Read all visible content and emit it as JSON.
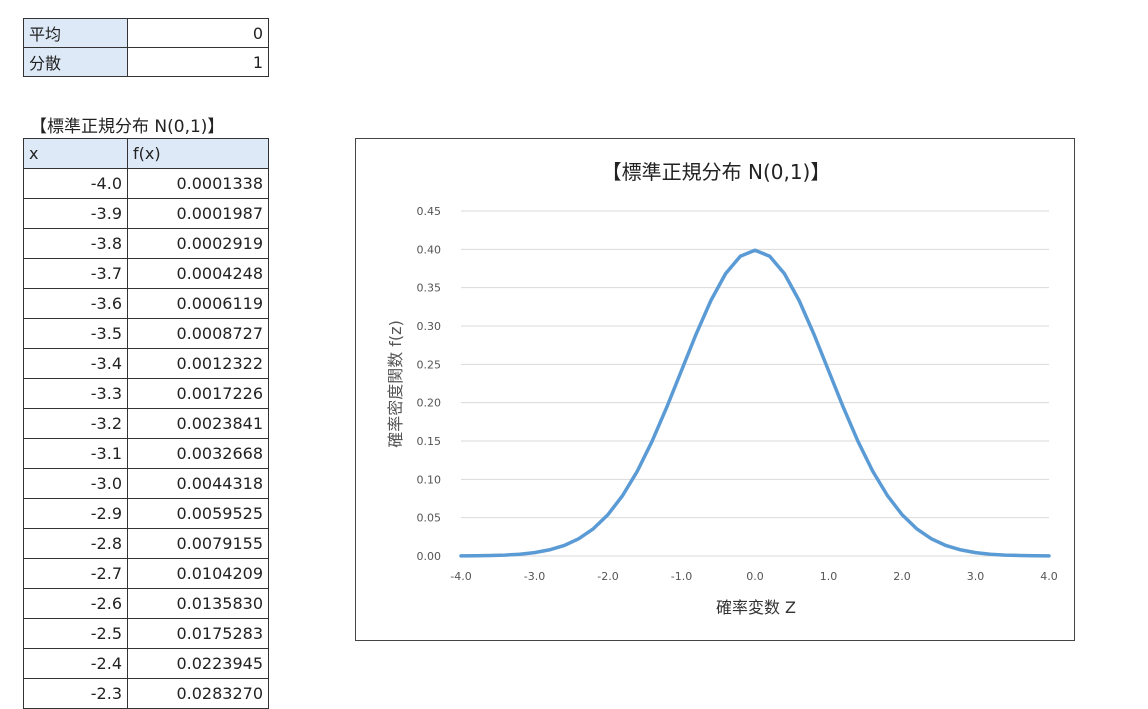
{
  "params": {
    "mean_label": "平均",
    "mean_value": "0",
    "variance_label": "分散",
    "variance_value": "1"
  },
  "table": {
    "title": "【標準正規分布 N(0,1)】",
    "col_x": "x",
    "col_fx": "f(x)",
    "rows": [
      {
        "x": "-4.0",
        "fx": "0.0001338"
      },
      {
        "x": "-3.9",
        "fx": "0.0001987"
      },
      {
        "x": "-3.8",
        "fx": "0.0002919"
      },
      {
        "x": "-3.7",
        "fx": "0.0004248"
      },
      {
        "x": "-3.6",
        "fx": "0.0006119"
      },
      {
        "x": "-3.5",
        "fx": "0.0008727"
      },
      {
        "x": "-3.4",
        "fx": "0.0012322"
      },
      {
        "x": "-3.3",
        "fx": "0.0017226"
      },
      {
        "x": "-3.2",
        "fx": "0.0023841"
      },
      {
        "x": "-3.1",
        "fx": "0.0032668"
      },
      {
        "x": "-3.0",
        "fx": "0.0044318"
      },
      {
        "x": "-2.9",
        "fx": "0.0059525"
      },
      {
        "x": "-2.8",
        "fx": "0.0079155"
      },
      {
        "x": "-2.7",
        "fx": "0.0104209"
      },
      {
        "x": "-2.6",
        "fx": "0.0135830"
      },
      {
        "x": "-2.5",
        "fx": "0.0175283"
      },
      {
        "x": "-2.4",
        "fx": "0.0223945"
      },
      {
        "x": "-2.3",
        "fx": "0.0283270"
      }
    ]
  },
  "chart_data": {
    "type": "line",
    "title": "【標準正規分布 N(0,1)】",
    "xlabel": "確率変数 Z",
    "ylabel": "確率密度関数 f(z)",
    "xlim": [
      -4.0,
      4.0
    ],
    "ylim": [
      0.0,
      0.45
    ],
    "x_ticks": [
      "-4.0",
      "-3.0",
      "-2.0",
      "-1.0",
      "0.0",
      "1.0",
      "2.0",
      "3.0",
      "4.0"
    ],
    "y_ticks": [
      "0.00",
      "0.05",
      "0.10",
      "0.15",
      "0.20",
      "0.25",
      "0.30",
      "0.35",
      "0.40",
      "0.45"
    ],
    "grid": "horizontal",
    "line_color": "#5b9bd5",
    "x": [
      -4.0,
      -3.8,
      -3.6,
      -3.4,
      -3.2,
      -3.0,
      -2.8,
      -2.6,
      -2.4,
      -2.2,
      -2.0,
      -1.8,
      -1.6,
      -1.4,
      -1.2,
      -1.0,
      -0.8,
      -0.6,
      -0.4,
      -0.2,
      0.0,
      0.2,
      0.4,
      0.6,
      0.8,
      1.0,
      1.2,
      1.4,
      1.6,
      1.8,
      2.0,
      2.2,
      2.4,
      2.6,
      2.8,
      3.0,
      3.2,
      3.4,
      3.6,
      3.8,
      4.0
    ],
    "y": [
      0.0001,
      0.0003,
      0.0006,
      0.0012,
      0.0024,
      0.0044,
      0.0079,
      0.0136,
      0.0224,
      0.0355,
      0.054,
      0.079,
      0.1109,
      0.1497,
      0.1942,
      0.242,
      0.2897,
      0.3332,
      0.3683,
      0.391,
      0.3989,
      0.391,
      0.3683,
      0.3332,
      0.2897,
      0.242,
      0.1942,
      0.1497,
      0.1109,
      0.079,
      0.054,
      0.0355,
      0.0224,
      0.0136,
      0.0079,
      0.0044,
      0.0024,
      0.0012,
      0.0006,
      0.0003,
      0.0001
    ]
  }
}
